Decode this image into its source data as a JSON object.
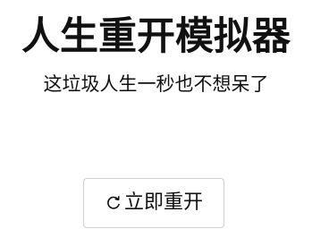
{
  "game": {
    "title": "人生重开模拟器",
    "subtitle": "这垃圾人生一秒也不想呆了"
  },
  "actions": {
    "restart_label": "立即重开",
    "restart_icon": "refresh-icon"
  }
}
